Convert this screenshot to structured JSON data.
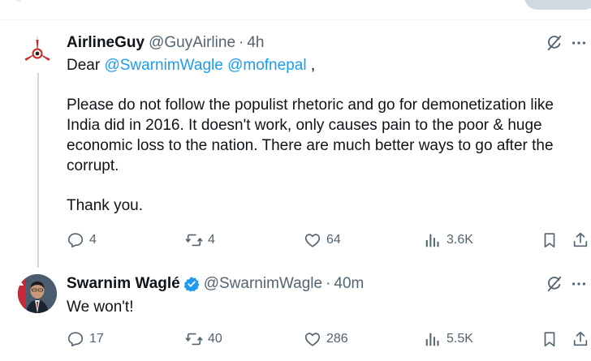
{
  "tweets": [
    {
      "author_name": "AirlineGuy",
      "handle": "@GuyAirline",
      "separator": "·",
      "time": "4h",
      "greeting": "Dear",
      "mentions": [
        "@SwarnimWagle",
        "@mofnepal"
      ],
      "after_mentions": " ,",
      "paragraph": "Please do not follow the populist rhetoric and go for demonetization like India did in 2016. It doesn't work, only causes pain to the poor & huge economic loss to the nation. There are much better ways to go after the corrupt.",
      "closing": "Thank you.",
      "metrics": {
        "replies": "4",
        "reposts": "4",
        "likes": "64",
        "views": "3.6K"
      }
    },
    {
      "author_name": "Swarnim Waglé",
      "verified": true,
      "handle": "@SwarnimWagle",
      "separator": "·",
      "time": "40m",
      "text": "We won't!",
      "metrics": {
        "replies": "17",
        "reposts": "40",
        "likes": "286",
        "views": "5.5K"
      }
    }
  ],
  "icons": [
    "grok-icon",
    "more-icon",
    "reply-icon",
    "repost-icon",
    "like-icon",
    "views-icon",
    "bookmark-icon",
    "share-icon",
    "verified-badge-icon"
  ],
  "colors": {
    "accent": "#1d9bf0",
    "text": "#0f1419",
    "secondary": "#536471",
    "thread_line": "#cfd9de"
  }
}
